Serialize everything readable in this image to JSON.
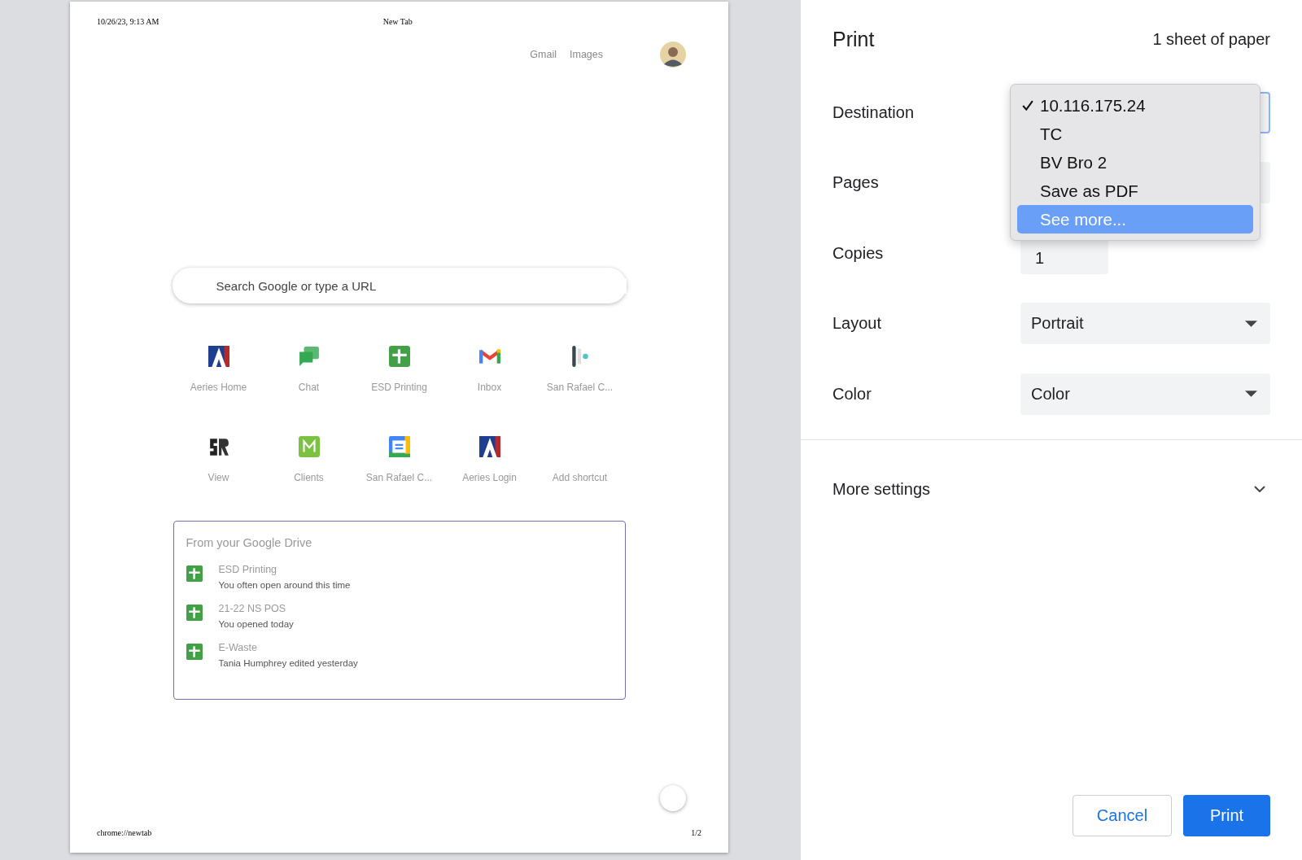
{
  "sheet": {
    "header_date": "10/26/23, 9:13 AM",
    "header_title": "New Tab",
    "footer_url": "chrome://newtab",
    "footer_page": "1/2",
    "top_links": [
      "Gmail",
      "Images"
    ],
    "search": {
      "placeholder": "Search Google or type a URL"
    },
    "shortcuts": [
      {
        "label": "Aeries Home",
        "kind": "aeries"
      },
      {
        "label": "Chat",
        "kind": "chat"
      },
      {
        "label": "ESD Printing",
        "kind": "sheets"
      },
      {
        "label": "Inbox",
        "kind": "mail"
      },
      {
        "label": "San Rafael C...",
        "kind": "bars"
      },
      {
        "label": "View",
        "kind": "logo"
      },
      {
        "label": "Clients",
        "kind": "green"
      },
      {
        "label": "San Rafael C...",
        "kind": "calendar"
      },
      {
        "label": "Aeries Login",
        "kind": "aeries"
      },
      {
        "label": "Add shortcut",
        "kind": "add"
      }
    ],
    "drive": {
      "title": "From your Google Drive",
      "items": [
        {
          "name": "ESD Printing",
          "detail": "You often open around this time"
        },
        {
          "name": "21-22 NS POS",
          "detail": "You opened today"
        },
        {
          "name": "E-Waste",
          "detail": "Tania Humphrey edited yesterday"
        }
      ]
    }
  },
  "print": {
    "title": "Print",
    "sheets": "1 sheet of paper",
    "settings": [
      {
        "label": "Destination",
        "kind": "select"
      },
      {
        "label": "Pages",
        "kind": "select"
      },
      {
        "label": "Copies",
        "kind": "input",
        "value": "1"
      },
      {
        "label": "Layout",
        "kind": "select",
        "value": "Portrait"
      },
      {
        "label": "Color",
        "kind": "select",
        "value": "Color"
      }
    ],
    "menu": [
      {
        "label": "10.116.175.24",
        "selected": true,
        "highlighted": false
      },
      {
        "label": "TC",
        "selected": false,
        "highlighted": false
      },
      {
        "label": "BV Bro 2",
        "selected": false,
        "highlighted": false
      },
      {
        "label": "Save as PDF",
        "selected": false,
        "highlighted": false
      },
      {
        "label": "See more...",
        "selected": false,
        "highlighted": true
      }
    ],
    "more_settings": {
      "label": "More settings",
      "expanded": false
    },
    "buttons": [
      {
        "label": "Cancel",
        "kind": "secondary"
      },
      {
        "label": "Print",
        "kind": "primary"
      }
    ]
  }
}
